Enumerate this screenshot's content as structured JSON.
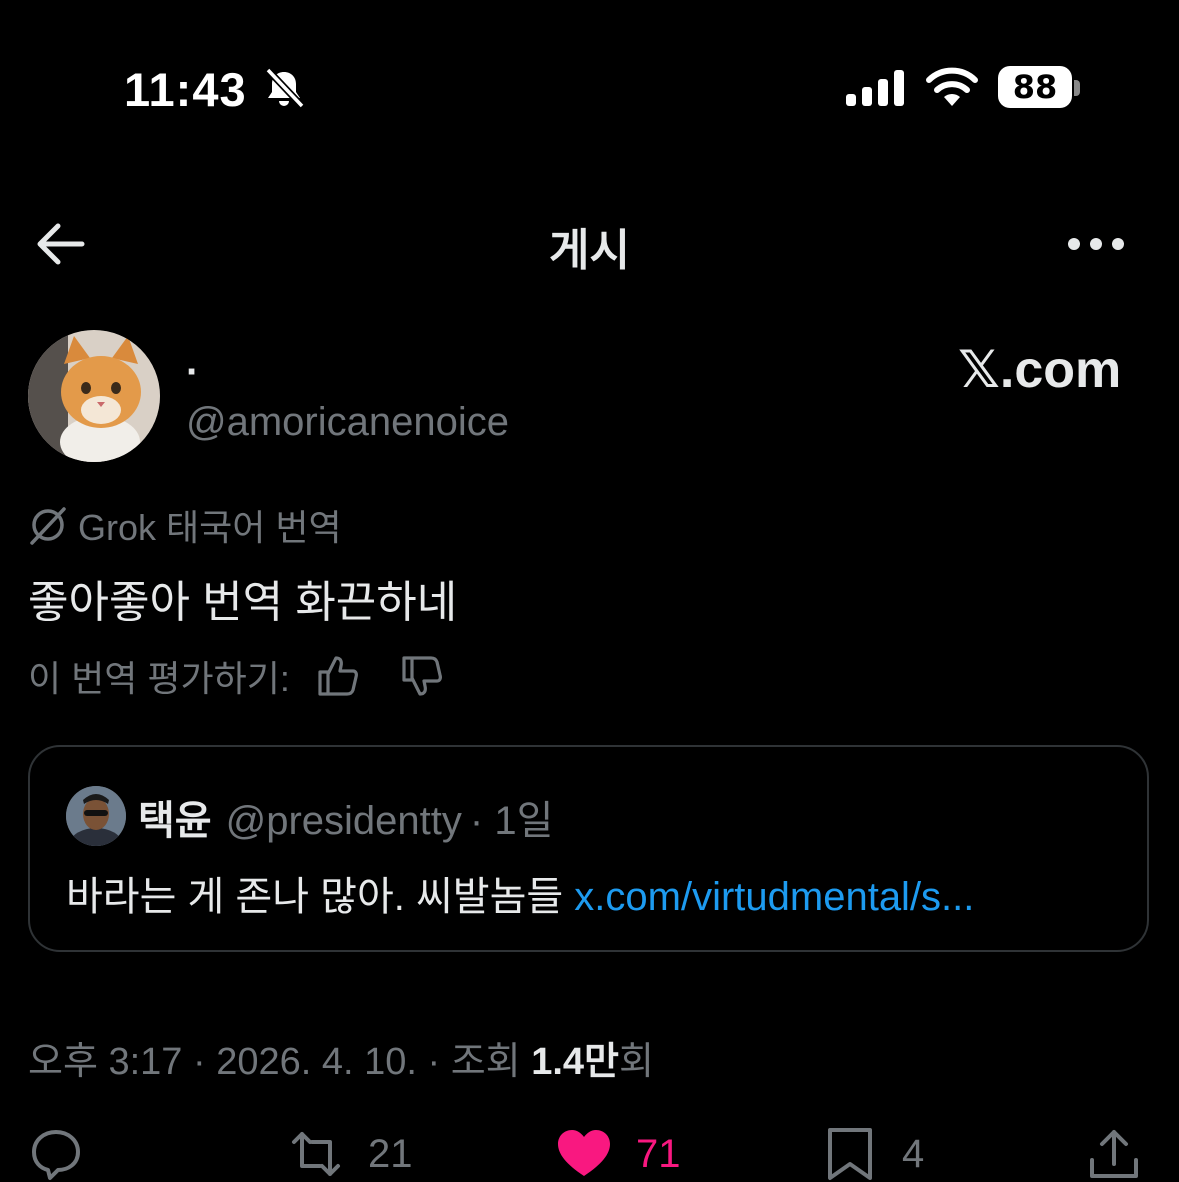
{
  "status_bar": {
    "time": "11:43",
    "battery": "88",
    "icons": [
      "bell-slash-icon",
      "signal-icon",
      "wifi-icon",
      "battery-icon"
    ]
  },
  "header": {
    "title": "게시",
    "back_icon": "arrow-left-icon",
    "more_icon": "more-icon"
  },
  "post": {
    "display_name": "·",
    "handle": "@amoricanenoice",
    "brand": "𝕏.com",
    "translation_label": "Grok 태국어 번역",
    "text": "좋아좋아 번역 화끈하네",
    "rate_label": "이 번역 평가하기:",
    "quote": {
      "name": "택윤",
      "handle": "@presidentty",
      "time": "· 1일",
      "text": "바라는 게 존나 많아. 씨발놈들 ",
      "link": "x.com/virtudmental/s..."
    },
    "meta": {
      "datetime": "오후 3:17 · 2026. 4. 10. · 조회 ",
      "views": "1.4만",
      "views_suffix": "회"
    },
    "actions": {
      "reply": "",
      "retweets": "21",
      "likes": "71",
      "bookmarks": "4"
    }
  },
  "colors": {
    "background": "#000000",
    "text": "#e7e9ea",
    "muted": "#71767b",
    "link": "#1d9bf0",
    "like": "#f91880",
    "border": "#2f3336"
  }
}
